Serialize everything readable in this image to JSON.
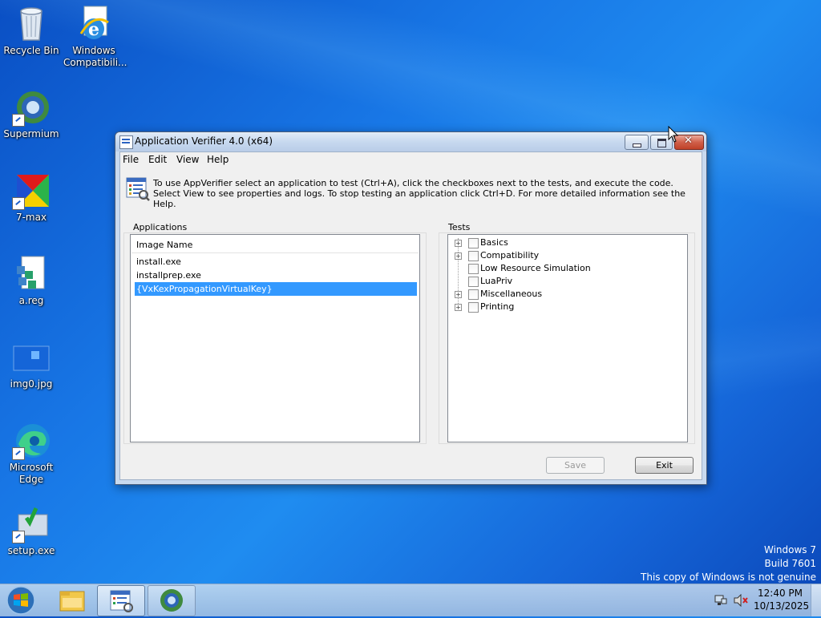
{
  "desktop": {
    "icons": [
      {
        "label": "Recycle Bin"
      },
      {
        "label": "Windows Compatibili..."
      },
      {
        "label": "Supermium"
      },
      {
        "label": "7-max"
      },
      {
        "label": "a.reg"
      },
      {
        "label": "img0.jpg"
      },
      {
        "label": "Microsoft Edge"
      },
      {
        "label": "setup.exe"
      }
    ],
    "watermark": {
      "line1": "Windows 7",
      "line2": "Build 7601",
      "line3": "This copy of Windows is not genuine"
    }
  },
  "window": {
    "title": "Application Verifier 4.0 (x64)",
    "menu": [
      "File",
      "Edit",
      "View",
      "Help"
    ],
    "info_text": "To use AppVerifier select an application to test (Ctrl+A), click the checkboxes next to the tests, and execute the code. Select View to see properties and logs. To stop testing an application click Ctrl+D. For more detailed information see the Help.",
    "applications": {
      "label": "Applications",
      "column_header": "Image Name",
      "items": [
        "install.exe",
        "installprep.exe",
        "{VxKexPropagationVirtualKey}"
      ],
      "selected_index": 2
    },
    "tests": {
      "label": "Tests",
      "items": [
        {
          "label": "Basics",
          "expandable": true,
          "checked": false
        },
        {
          "label": "Compatibility",
          "expandable": true,
          "checked": false
        },
        {
          "label": "Low Resource Simulation",
          "expandable": false,
          "checked": false
        },
        {
          "label": "LuaPriv",
          "expandable": false,
          "checked": false
        },
        {
          "label": "Miscellaneous",
          "expandable": true,
          "checked": false
        },
        {
          "label": "Printing",
          "expandable": true,
          "checked": false
        }
      ]
    },
    "buttons": {
      "save": "Save",
      "save_enabled": false,
      "exit": "Exit"
    }
  },
  "taskbar": {
    "time": "12:40 PM",
    "date": "10/13/2025",
    "items": [
      "windows-explorer",
      "application-verifier",
      "supermium"
    ],
    "active_item": "application-verifier"
  }
}
